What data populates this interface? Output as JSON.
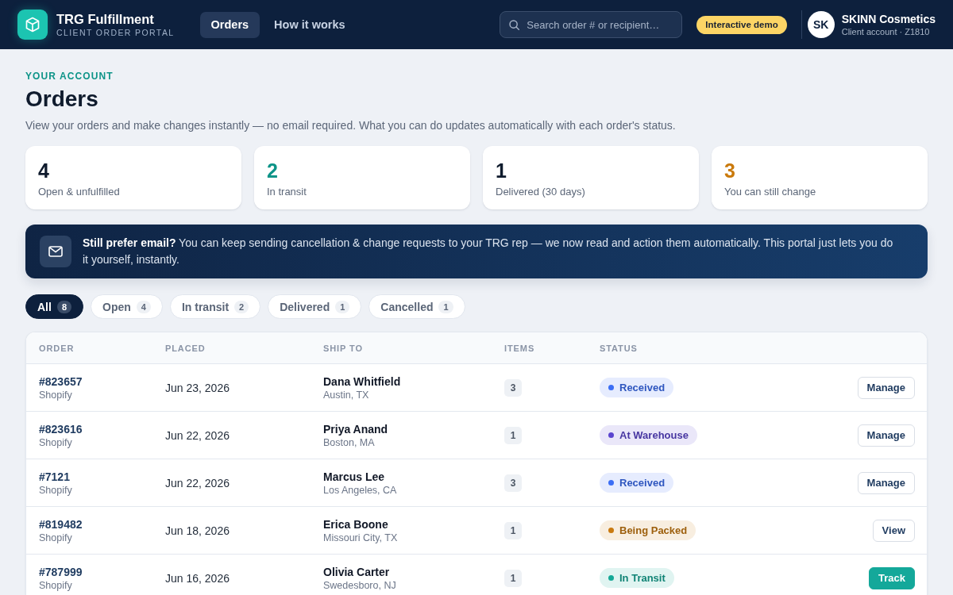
{
  "header": {
    "brand": {
      "name": "TRG Fulfillment",
      "tagline": "CLIENT ORDER PORTAL"
    },
    "nav": [
      {
        "label": "Orders",
        "selected": true
      },
      {
        "label": "How it works",
        "selected": false
      }
    ],
    "search": {
      "placeholder": "Search order # or recipient…"
    },
    "badge": "Interactive demo",
    "account": {
      "initials": "SK",
      "name": "SKINN Cosmetics",
      "detail": "Client account · Z1810"
    }
  },
  "page": {
    "eyebrow": "YOUR ACCOUNT",
    "title": "Orders",
    "description": "View your orders and make changes instantly — no email required. What you can do updates automatically with each order's status."
  },
  "stats": [
    {
      "value": "4",
      "label": "Open & unfulfilled",
      "color": "#0f1b2d"
    },
    {
      "value": "2",
      "label": "In transit",
      "color": "#0d9488"
    },
    {
      "value": "1",
      "label": "Delivered (30 days)",
      "color": "#0f1b2d"
    },
    {
      "value": "3",
      "label": "You can still change",
      "color": "#ca7a0c"
    }
  ],
  "notice": {
    "text": "**Still prefer email?** You can keep sending cancellation & change requests to your TRG rep — we now read and action them automatically. This portal just lets you do it yourself, instantly."
  },
  "filters": [
    {
      "label": "All",
      "count": "8",
      "selected": true
    },
    {
      "label": "Open",
      "count": "4",
      "selected": false
    },
    {
      "label": "In transit",
      "count": "2",
      "selected": false
    },
    {
      "label": "Delivered",
      "count": "1",
      "selected": false
    },
    {
      "label": "Cancelled",
      "count": "1",
      "selected": false
    }
  ],
  "table": {
    "columns": [
      "ORDER",
      "PLACED",
      "SHIP TO",
      "ITEMS",
      "STATUS"
    ],
    "rows": [
      {
        "order": "#823657",
        "channel": "Shopify",
        "placed": "Jun 23, 2026",
        "recipient": "Dana Whitfield",
        "location": "Austin, TX",
        "items": "3",
        "status": {
          "label": "Received",
          "color": "#3b6ef5"
        },
        "action": {
          "label": "Manage",
          "kind": "outline"
        }
      },
      {
        "order": "#823616",
        "channel": "Shopify",
        "placed": "Jun 22, 2026",
        "recipient": "Priya Anand",
        "location": "Boston, MA",
        "items": "1",
        "status": {
          "label": "At Warehouse",
          "color": "#5b45cf"
        },
        "action": {
          "label": "Manage",
          "kind": "outline"
        }
      },
      {
        "order": "#7121",
        "channel": "Shopify",
        "placed": "Jun 22, 2026",
        "recipient": "Marcus Lee",
        "location": "Los Angeles, CA",
        "items": "3",
        "status": {
          "label": "Received",
          "color": "#3b6ef5"
        },
        "action": {
          "label": "Manage",
          "kind": "outline"
        }
      },
      {
        "order": "#819482",
        "channel": "Shopify",
        "placed": "Jun 18, 2026",
        "recipient": "Erica Boone",
        "location": "Missouri City, TX",
        "items": "1",
        "status": {
          "label": "Being Packed",
          "color": "#c97a10"
        },
        "action": {
          "label": "View",
          "kind": "outline"
        }
      },
      {
        "order": "#787999",
        "channel": "Shopify",
        "placed": "Jun 16, 2026",
        "recipient": "Olivia Carter",
        "location": "Swedesboro, NJ",
        "items": "1",
        "status": {
          "label": "In Transit",
          "color": "#14a896"
        },
        "action": {
          "label": "Track",
          "kind": "primary"
        }
      }
    ]
  }
}
